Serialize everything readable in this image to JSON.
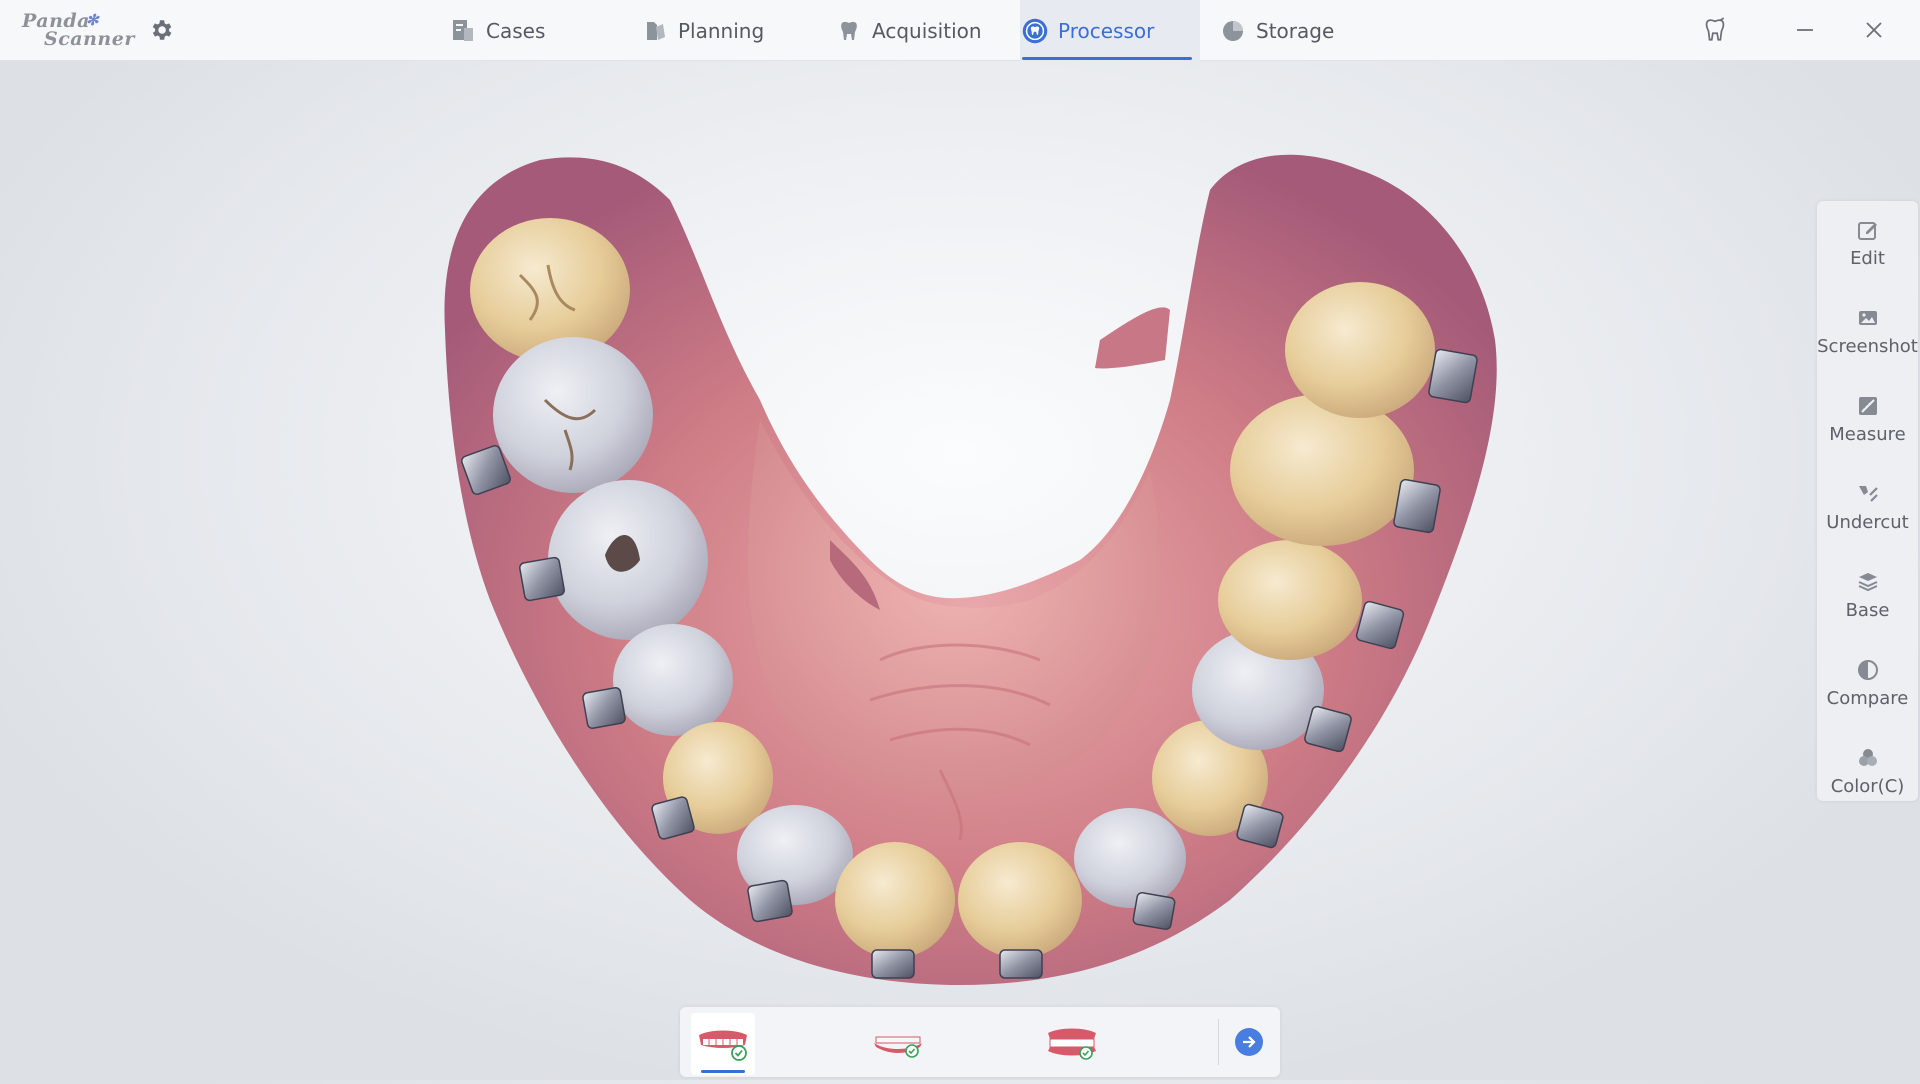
{
  "app": {
    "logo_line1": "Panda",
    "logo_line2": "Scanner"
  },
  "nav": {
    "cases": "Cases",
    "planning": "Planning",
    "acquisition": "Acquisition",
    "processor": "Processor",
    "storage": "Storage",
    "active": "Processor"
  },
  "tools": {
    "edit": "Edit",
    "screenshot": "Screenshot",
    "measure": "Measure",
    "undercut": "Undercut",
    "base": "Base",
    "compare": "Compare",
    "color": "Color(C)"
  },
  "bottom": {
    "jaws": [
      {
        "icon": "upper-jaw-checked-icon",
        "active": true
      },
      {
        "icon": "lower-jaw-checked-icon",
        "active": false
      },
      {
        "icon": "bite-checked-icon",
        "active": false
      }
    ],
    "next_icon": "arrow-right-icon"
  },
  "colors": {
    "accent": "#3a6fd6",
    "check": "#3aa05a",
    "gum": "#c96a78",
    "tooth": "#e9d3a8"
  }
}
